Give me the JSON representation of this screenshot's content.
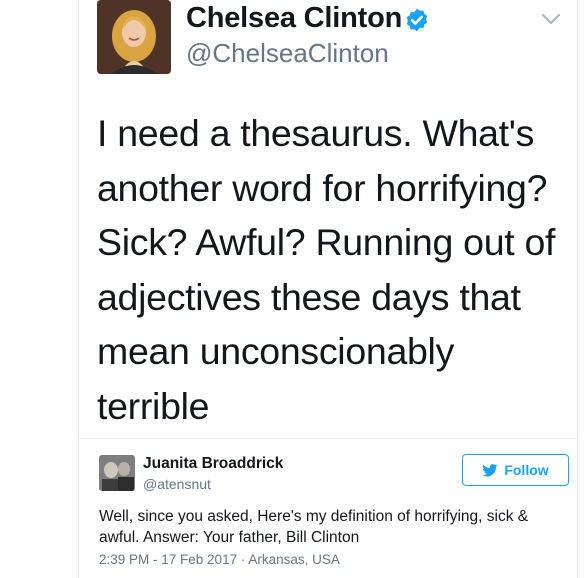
{
  "tweet": {
    "author": {
      "display_name": "Chelsea Clinton",
      "handle": "@ChelseaClinton",
      "verified": true
    },
    "text": "I need a thesaurus. What's another word for horrifying? Sick? Awful? Running out of adjectives these days that mean unconscionably terrible",
    "icons": {
      "verified": "verified-badge-icon",
      "menu": "chevron-down-icon"
    }
  },
  "reply": {
    "author": {
      "display_name": "Juanita Broaddrick",
      "handle": "@atensnut"
    },
    "follow_label": "Follow",
    "text": "Well, since you asked, Here's my definition of horrifying, sick & awful. Answer: Your father, Bill Clinton",
    "timestamp": "2:39 PM - 17 Feb 2017",
    "separator": "·",
    "location": "Arkansas, USA"
  },
  "colors": {
    "brand_blue": "#1da1f2",
    "text": "#14171a",
    "secondary_text": "#657786",
    "border": "#e6ecf0"
  }
}
